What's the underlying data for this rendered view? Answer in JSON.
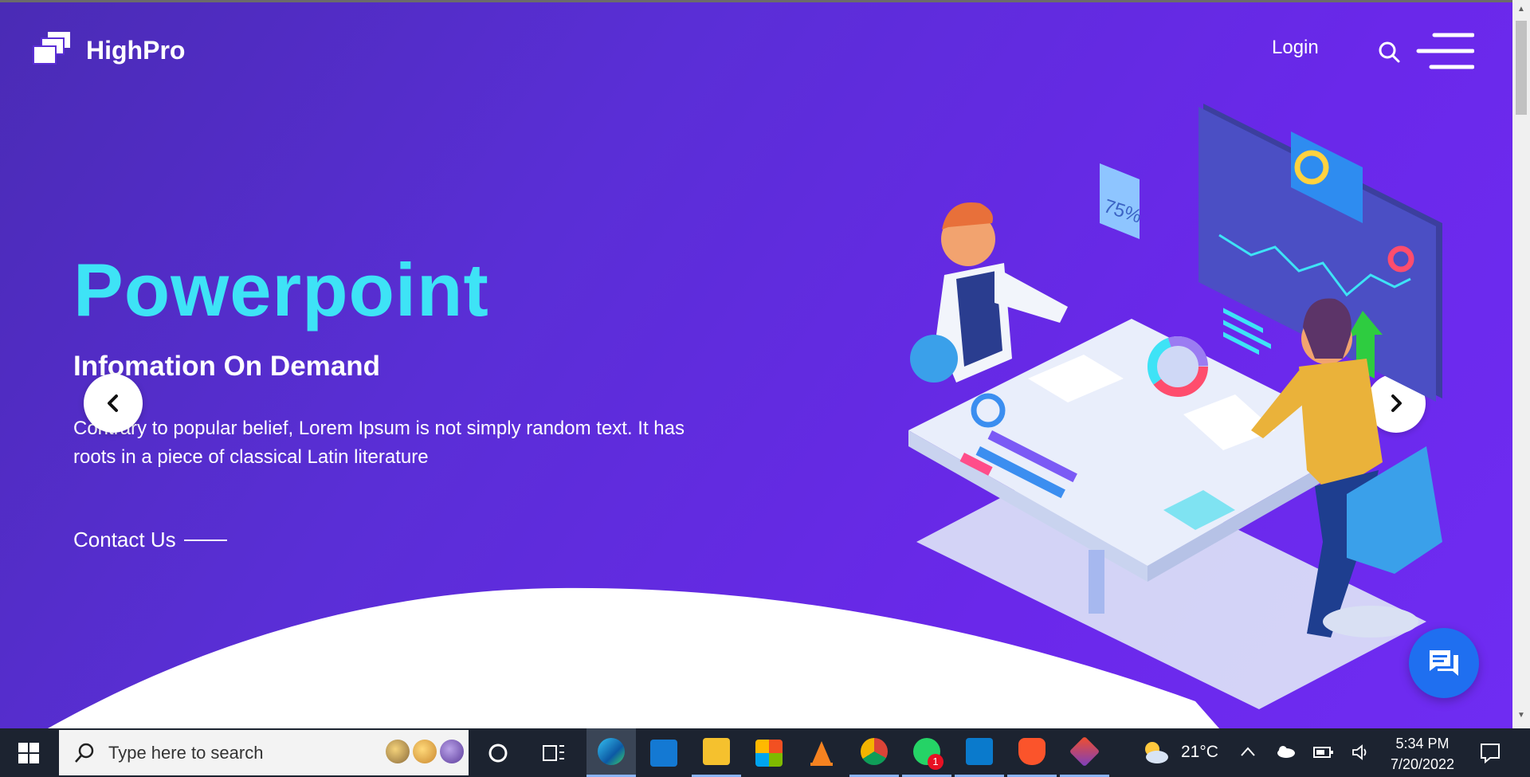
{
  "header": {
    "brand": "HighPro",
    "login_label": "Login"
  },
  "hero": {
    "title": "Powerpoint",
    "subtitle": "Infomation On Demand",
    "description": "Contrary to popular belief, Lorem Ipsum is not simply random text. It has roots in a piece of classical Latin literature",
    "contact_label": "Contact Us",
    "illustration_badge": "75%"
  },
  "colors": {
    "hero_start": "#4a2bb5",
    "hero_end": "#6f2cf2",
    "title_accent": "#3ee3f6",
    "chat_button": "#1f6ff0",
    "taskbar": "#1c2330"
  },
  "icons": {
    "logo": "stacked-pages-icon",
    "search": "search-icon",
    "menu": "hamburger-menu-icon",
    "prev": "chevron-left-icon",
    "next": "chevron-right-icon",
    "chat": "chat-bubbles-icon"
  },
  "taskbar": {
    "search_placeholder": "Type here to search",
    "apps": [
      "cortana",
      "task-view",
      "edge",
      "mail",
      "file-explorer",
      "microsoft-store",
      "vlc",
      "chrome",
      "whatsapp",
      "vscode",
      "brave",
      "git"
    ],
    "whatsapp_badge": "1",
    "weather": "21°C",
    "time": "5:34 PM",
    "date": "7/20/2022"
  }
}
